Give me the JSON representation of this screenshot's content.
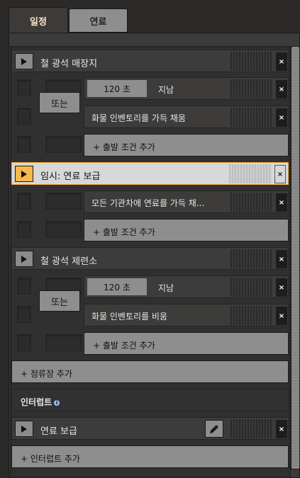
{
  "tabs": [
    {
      "label": "일정",
      "active": true
    },
    {
      "label": "연료",
      "active": false
    }
  ],
  "schedule": [
    {
      "station": "철 광석 매장지",
      "active": false,
      "or_label": "또는",
      "conditions": [
        {
          "time": "120 초",
          "label": "지남"
        },
        {
          "label": "화물 인벤토리를 가득 채움"
        }
      ],
      "add_condition": "+ 출발 조건 추가"
    },
    {
      "station": "임시: 연료 보급",
      "active": true,
      "conditions": [
        {
          "label": "모든 기관차에 연료를 가득 채..."
        }
      ],
      "add_condition": "+ 출발 조건 추가"
    },
    {
      "station": "철 광석 제련소",
      "active": false,
      "or_label": "또는",
      "conditions": [
        {
          "time": "120 초",
          "label": "지남"
        },
        {
          "label": "화물 인벤토리를 비움"
        }
      ],
      "add_condition": "+ 출발 조건 추가"
    }
  ],
  "add_station": "+ 정류장 추가",
  "interrupts": {
    "title": "인터럽트",
    "info_icon": "info-icon",
    "items": [
      {
        "label": "연료 보급"
      }
    ],
    "add_interrupt": "+ 인터럽트 추가"
  },
  "icons": {
    "play": "play-icon",
    "close": "close-icon",
    "edit": "pencil-icon"
  },
  "colors": {
    "accent": "#f7b84b",
    "background": "#2b2a29",
    "button": "#8e8e8e"
  }
}
